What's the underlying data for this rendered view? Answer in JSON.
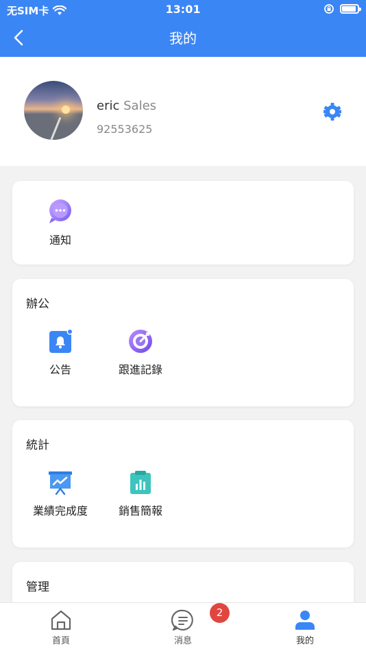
{
  "status_bar": {
    "carrier": "无SIM卡",
    "time": "13:01"
  },
  "nav": {
    "title": "我的"
  },
  "profile": {
    "name": "eric",
    "role": "Sales",
    "phone": "92553625"
  },
  "sections": [
    {
      "title": "",
      "items": [
        {
          "label": "通知",
          "icon": "chat-bubble-icon"
        }
      ]
    },
    {
      "title": "辦公",
      "items": [
        {
          "label": "公告",
          "icon": "bell-icon"
        },
        {
          "label": "跟進記錄",
          "icon": "target-icon"
        }
      ]
    },
    {
      "title": "統計",
      "items": [
        {
          "label": "業績完成度",
          "icon": "presentation-chart-icon"
        },
        {
          "label": "銷售簡報",
          "icon": "clipboard-chart-icon"
        }
      ]
    },
    {
      "title": "管理",
      "items": []
    }
  ],
  "tabbar": {
    "items": [
      {
        "label": "首頁",
        "icon": "home-icon"
      },
      {
        "label": "消息",
        "icon": "message-icon",
        "badge": "2"
      },
      {
        "label": "我的",
        "icon": "user-icon",
        "active": true
      }
    ]
  },
  "colors": {
    "primary": "#3b86f5",
    "badge": "#e0463f"
  }
}
